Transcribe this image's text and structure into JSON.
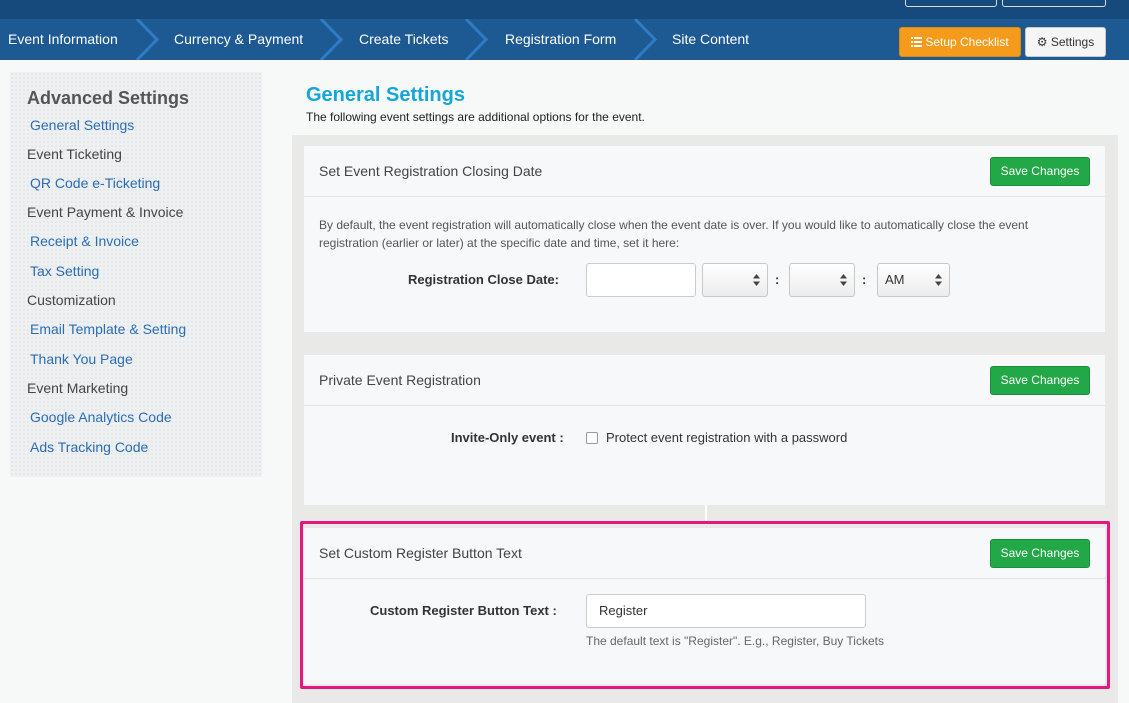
{
  "nav": {
    "steps": [
      "Event Information",
      "Currency & Payment",
      "Create Tickets",
      "Registration Form",
      "Site Content"
    ],
    "setup_checklist": "Setup Checklist",
    "settings": "Settings"
  },
  "sidebar": {
    "title": "Advanced Settings",
    "items": [
      {
        "label": "General Settings",
        "kind": "link"
      },
      {
        "label": "Event Ticketing",
        "kind": "group"
      },
      {
        "label": "QR Code e-Ticketing",
        "kind": "link"
      },
      {
        "label": "Event Payment & Invoice",
        "kind": "group"
      },
      {
        "label": "Receipt & Invoice",
        "kind": "link"
      },
      {
        "label": "Tax Setting",
        "kind": "link"
      },
      {
        "label": "Customization",
        "kind": "group"
      },
      {
        "label": "Email Template & Setting",
        "kind": "link"
      },
      {
        "label": "Thank You Page",
        "kind": "link"
      },
      {
        "label": "Event Marketing",
        "kind": "group"
      },
      {
        "label": "Google Analytics Code",
        "kind": "link"
      },
      {
        "label": "Ads Tracking Code",
        "kind": "link"
      }
    ]
  },
  "main": {
    "title": "General Settings",
    "subtitle": "The following event settings are additional options for the event.",
    "save_label": "Save Changes",
    "closing": {
      "title": "Set Event Registration Closing Date",
      "description": "By default, the event registration will automatically close when the event date is over. If you would like to automatically close the event registration (earlier or later) at the specific date and time, set it here:",
      "label": "Registration Close Date:",
      "ampm": "AM"
    },
    "private": {
      "title": "Private Event Registration",
      "label": "Invite-Only event :",
      "checkbox_label": "Protect event registration with a password"
    },
    "custom": {
      "title": "Set Custom Register Button Text",
      "label": "Custom Register Button Text :",
      "value": "Register",
      "hint": "The default text is \"Register\". E.g., Register, Buy Tickets"
    }
  },
  "colors": {
    "nav_bg": "#1d5a94",
    "accent_orange": "#f49b1b",
    "save_green": "#22a846",
    "title_blue": "#14a6d9",
    "highlight": "#e6187f"
  }
}
